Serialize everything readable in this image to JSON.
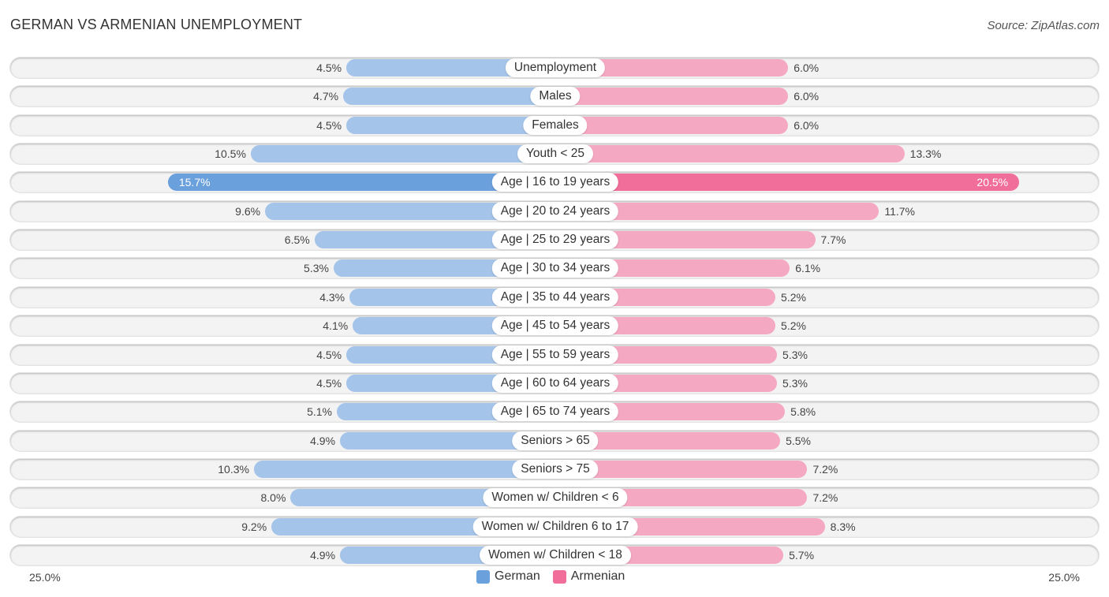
{
  "title": "GERMAN VS ARMENIAN UNEMPLOYMENT",
  "source": "Source: ZipAtlas.com",
  "colors": {
    "german": "#a4c4e9",
    "armenian": "#f5a8c2",
    "german_highlight": "#6aa0dc",
    "armenian_highlight": "#f06e99"
  },
  "chart_data": {
    "type": "bar",
    "orientation": "horizontal-diverging",
    "title": "GERMAN VS ARMENIAN UNEMPLOYMENT",
    "xlim": [
      0,
      25
    ],
    "axis_labels": {
      "left": "25.0%",
      "right": "25.0%"
    },
    "legend": {
      "position": "bottom-center",
      "entries": [
        "German",
        "Armenian"
      ]
    },
    "categories": [
      "Unemployment",
      "Males",
      "Females",
      "Youth < 25",
      "Age | 16 to 19 years",
      "Age | 20 to 24 years",
      "Age | 25 to 29 years",
      "Age | 30 to 34 years",
      "Age | 35 to 44 years",
      "Age | 45 to 54 years",
      "Age | 55 to 59 years",
      "Age | 60 to 64 years",
      "Age | 65 to 74 years",
      "Seniors > 65",
      "Seniors > 75",
      "Women w/ Children < 6",
      "Women w/ Children 6 to 17",
      "Women w/ Children < 18"
    ],
    "series": [
      {
        "name": "German",
        "values": [
          4.5,
          4.7,
          4.5,
          10.5,
          15.7,
          9.6,
          6.5,
          5.3,
          4.3,
          4.1,
          4.5,
          4.5,
          5.1,
          4.9,
          10.3,
          8.0,
          9.2,
          4.9
        ]
      },
      {
        "name": "Armenian",
        "values": [
          6.0,
          6.0,
          6.0,
          13.3,
          20.5,
          11.7,
          7.7,
          6.1,
          5.2,
          5.2,
          5.3,
          5.3,
          5.8,
          5.5,
          7.2,
          7.2,
          8.3,
          5.7
        ]
      }
    ],
    "highlight_index": 4
  }
}
